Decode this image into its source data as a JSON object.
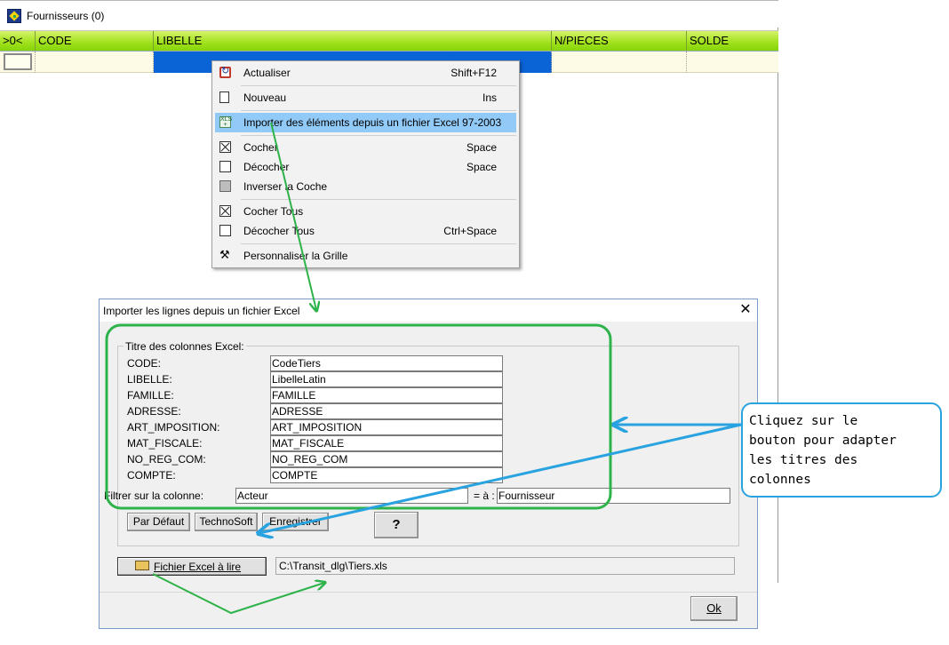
{
  "window": {
    "title": "Fournisseurs (0)"
  },
  "grid": {
    "columns": [
      ">0<",
      "CODE",
      "LIBELLE",
      "N/PIECES",
      "SOLDE"
    ]
  },
  "context_menu": {
    "items": [
      {
        "label": "Actualiser",
        "shortcut": "Shift+F12",
        "icon": "refresh-icon"
      },
      {
        "label": "Nouveau",
        "shortcut": "Ins",
        "icon": "new-document-icon"
      },
      {
        "label": "Importer des éléments depuis un fichier Excel 97-2003",
        "shortcut": "",
        "icon": "excel-import-icon",
        "highlighted": true
      },
      {
        "label": "Cocher",
        "shortcut": "Space",
        "icon": "checked-box-icon"
      },
      {
        "label": "Décocher",
        "shortcut": "Space",
        "icon": "unchecked-box-icon"
      },
      {
        "label": "Inverser la Coche",
        "shortcut": "",
        "icon": "invert-check-icon"
      },
      {
        "label": "Cocher Tous",
        "shortcut": "",
        "icon": "checked-box-icon"
      },
      {
        "label": "Décocher Tous",
        "shortcut": "Ctrl+Space",
        "icon": "unchecked-box-icon"
      },
      {
        "label": "Personnaliser la Grille",
        "shortcut": "",
        "icon": "tools-icon"
      }
    ]
  },
  "dialog": {
    "title": "Importer les lignes depuis un fichier Excel",
    "close_glyph": "✕",
    "group_title": "Titre des colonnes Excel:",
    "fields": [
      {
        "label": "CODE:",
        "value": "CodeTiers"
      },
      {
        "label": "LIBELLE:",
        "value": "LibelleLatin"
      },
      {
        "label": "FAMILLE:",
        "value": "FAMILLE"
      },
      {
        "label": "ADRESSE:",
        "value": "ADRESSE"
      },
      {
        "label": "ART_IMPOSITION:",
        "value": "ART_IMPOSITION"
      },
      {
        "label": "MAT_FISCALE:",
        "value": "MAT_FISCALE"
      },
      {
        "label": "NO_REG_COM:",
        "value": "NO_REG_COM"
      },
      {
        "label": "COMPTE:",
        "value": "COMPTE"
      }
    ],
    "filter": {
      "label": "Filtrer sur la colonne:",
      "column_value": "Acteur",
      "equals_label": "= à :",
      "equals_value": "Fournisseur"
    },
    "buttons": {
      "default": "Par Défaut",
      "technosoft": "TechnoSoft",
      "save": "Enregistrer",
      "help": "?",
      "excel_file": "Fichier Excel à lire",
      "ok": "Ok"
    },
    "file_path": "C:\\Transit_dlg\\Tiers.xls"
  },
  "callout": {
    "text_lines": [
      "Cliquez sur le",
      "bouton pour adapter",
      "les titres des",
      "colonnes"
    ]
  },
  "colors": {
    "header_green": "#9fe11a",
    "selection_blue": "#0a64d6",
    "menu_highlight": "#91c9f7",
    "annotation_green": "#2db34a",
    "annotation_blue": "#29a3e0"
  }
}
